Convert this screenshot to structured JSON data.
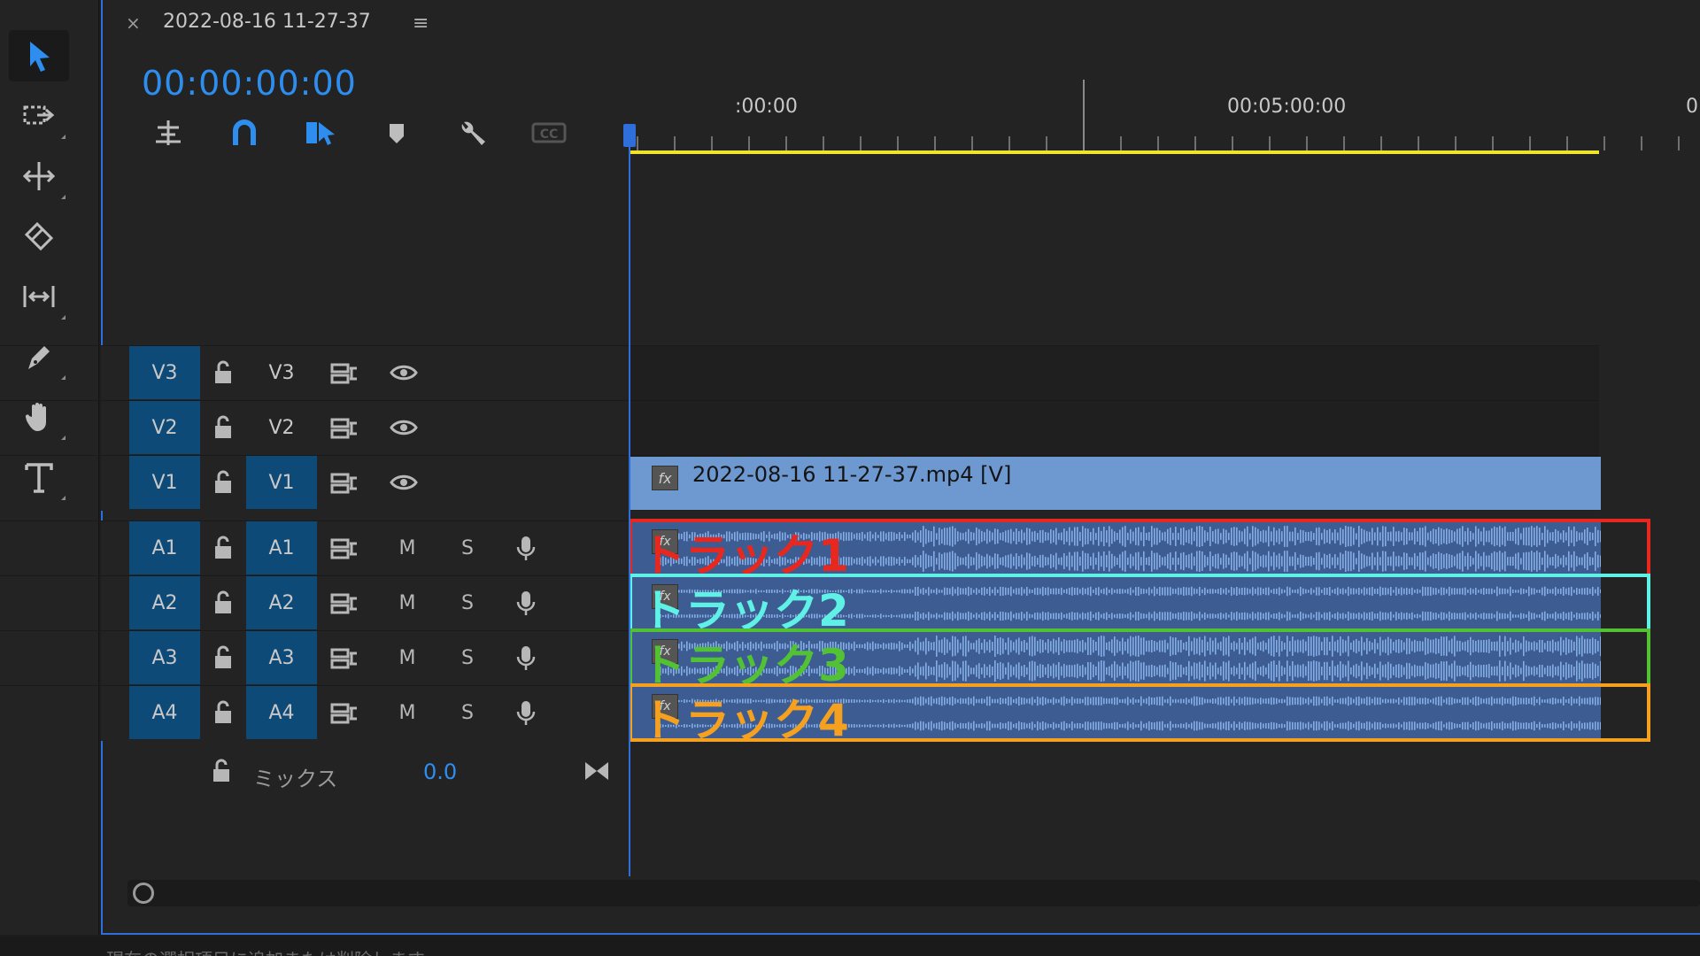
{
  "tab": {
    "close": "×",
    "title": "2022-08-16 11-27-37",
    "menu": "≡"
  },
  "timecode": "00:00:00:00",
  "ruler": {
    "labels": [
      ":00:00",
      "00:05:00:00",
      "0"
    ]
  },
  "video_tracks": [
    {
      "source": "V3",
      "target": "V3",
      "source_on": true,
      "target_on": false
    },
    {
      "source": "V2",
      "target": "V2",
      "source_on": true,
      "target_on": false
    },
    {
      "source": "V1",
      "target": "V1",
      "source_on": true,
      "target_on": true
    }
  ],
  "audio_tracks": [
    {
      "source": "A1",
      "target": "A1",
      "m": "M",
      "s": "S"
    },
    {
      "source": "A2",
      "target": "A2",
      "m": "M",
      "s": "S"
    },
    {
      "source": "A3",
      "target": "A3",
      "m": "M",
      "s": "S"
    },
    {
      "source": "A4",
      "target": "A4",
      "m": "M",
      "s": "S"
    }
  ],
  "mix": {
    "label": "ミックス",
    "value": "0.0"
  },
  "video_clip": {
    "fx": "fx",
    "name": "2022-08-16 11-27-37.mp4 [V]"
  },
  "annotations": [
    {
      "label": "トラック1",
      "color": "#e8281e"
    },
    {
      "label": "トラック2",
      "color": "#5ff0e6"
    },
    {
      "label": "トラック3",
      "color": "#52c234"
    },
    {
      "label": "トラック4",
      "color": "#f5a01e"
    }
  ],
  "status": {
    "text": "現在の選択項目に追加または削除します"
  },
  "colors": {
    "accent": "#2e8ef0",
    "work_area": "#f0e42b",
    "video_clip": "#6d98d0",
    "audio_clip": "#3d5c92"
  }
}
